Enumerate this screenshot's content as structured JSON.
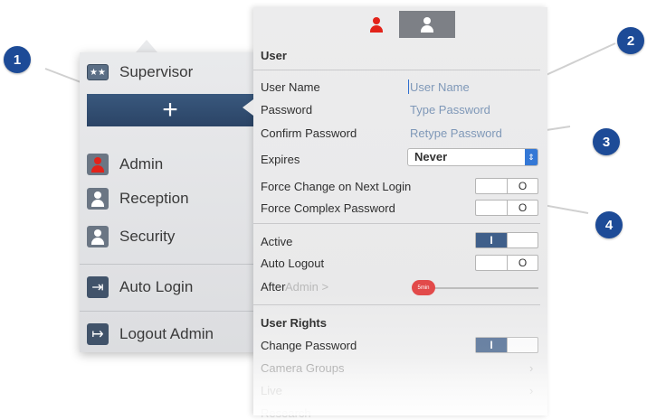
{
  "left_menu": {
    "supervisor": "Supervisor",
    "add_symbol": "+",
    "users": [
      {
        "label": "Admin",
        "icon": "admin-user-icon"
      },
      {
        "label": "Reception",
        "icon": "user-icon"
      },
      {
        "label": "Security",
        "icon": "user-icon"
      }
    ],
    "auto_login": "Auto Login",
    "logout": "Logout Admin"
  },
  "segments": {
    "selected": "admin-user-icon",
    "other": "user-icon"
  },
  "form": {
    "section_user": "User",
    "user_name_label": "User Name",
    "user_name_placeholder": "User Name",
    "password_label": "Password",
    "password_placeholder": "Type Password",
    "confirm_label": "Confirm Password",
    "confirm_placeholder": "Retype Password",
    "expires_label": "Expires",
    "expires_value": "Never",
    "force_change_label": "Force Change on Next Login",
    "force_change_state": "O",
    "force_complex_label": "Force Complex Password",
    "force_complex_state": "O",
    "active_label": "Active",
    "active_state": "I",
    "auto_logout_label": "Auto Logout",
    "auto_logout_state": "O",
    "after_label": "After",
    "after_ghost": "Admin  >",
    "after_value": "5min",
    "section_rights": "User Rights",
    "change_password_label": "Change Password",
    "change_password_state": "I",
    "camera_groups_label": "Camera Groups",
    "live_label": "Live",
    "research_label": "Research"
  },
  "callouts": [
    "1",
    "2",
    "3",
    "4"
  ],
  "colors": {
    "accent": "#1d4b97",
    "toggle_on": "#3f5f8a",
    "brand_red": "#e2231a"
  }
}
